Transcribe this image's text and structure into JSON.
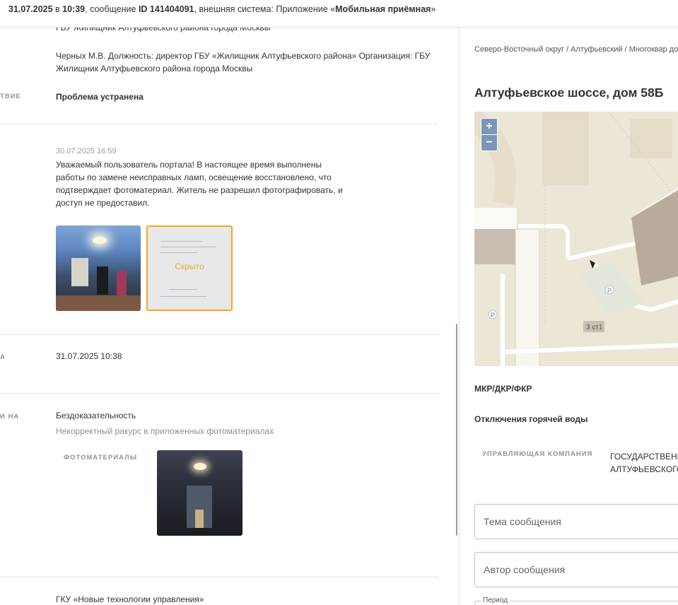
{
  "header": {
    "datetime": "31.07.2025",
    "in_word": " в ",
    "time": "10:39",
    "msg_prefix": ", сообщение ",
    "message_id": "ID 141404091",
    "system_prefix": ", внешняя система: Приложение «",
    "system_name": "Мобильная приёмная",
    "system_suffix": "»"
  },
  "left": {
    "org_line_top": "ГБУ Жилищник Алтуфьевского района города Москвы",
    "responsible": "Черных М.В. Должность: директор ГБУ «Жилищник Алтуфьевского района» Организация: ГБУ Жилищник Алтуфьевского района города Москвы",
    "status_label_edge": "ТВИЕ",
    "status_value": "Проблема устранена",
    "answer_date": "30.07.2025 16:59",
    "answer_text": "Уважаемый пользователь портала! В настоящее время выполнены работы по замене неисправных ламп, освещение восстановлено, что подтверждает фотоматериал. Житель не разрешил фотографировать, и доступ не предоставил.",
    "hidden_label": "Скрыто",
    "date_label_edge": "А",
    "date_value": "31.07.2025 10:38",
    "reason_label_edge": "И НА",
    "reason_title": "Бездоказательность",
    "reason_detail": "Некорректный ракурс в приложенных фотоматериалах",
    "photos_label": "ФОТОМАТЕРИАЛЫ",
    "bottom_org": "ГКУ «Новые технологии управления»"
  },
  "right": {
    "breadcrumbs": "Северо-Восточный округ / Алтуфьевский / Многоквар дом",
    "address": "Алтуфьевское шоссе, дом 58Б",
    "map": {
      "zoom_in": "+",
      "zoom_out": "−",
      "building_label": "3 ст1",
      "parking_symbol": "P"
    },
    "section1": "МКР/ДКР/ФКР",
    "section2": "Отключения горячей воды",
    "mgmt_label": "УПРАВЛЯЮЩАЯ КОМПАНИЯ",
    "mgmt_value_1": "ГОСУДАРСТВЕНН",
    "mgmt_value_2": "АЛТУФЬЕВСКОГО",
    "topic_placeholder": "Тема сообщения",
    "author_placeholder": "Автор сообщения",
    "period_legend": "Период"
  },
  "colors": {
    "accent": "#f5a623",
    "map_bg": "#ece6d6",
    "zoom_bg": "#7b96b8"
  }
}
